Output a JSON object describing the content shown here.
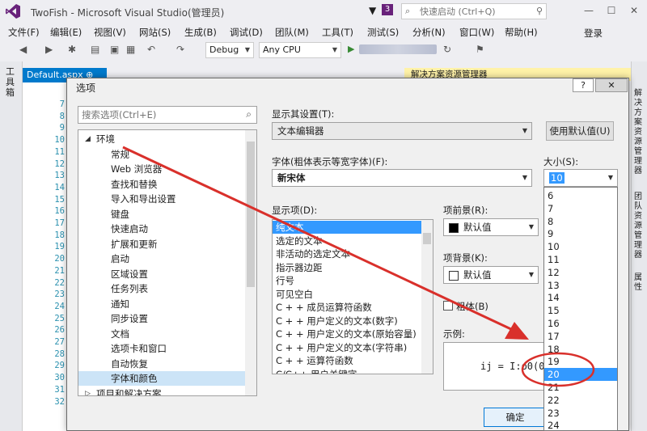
{
  "window": {
    "title": "TwoFish - Microsoft Visual Studio(管理员)",
    "notification_count": "3",
    "quick_launch_placeholder": "快速启动 (Ctrl+Q)",
    "minimize": "—",
    "maximize": "☐",
    "close": "✕"
  },
  "menu": {
    "items": [
      "文件(F)",
      "编辑(E)",
      "视图(V)",
      "网站(S)",
      "生成(B)",
      "调试(D)",
      "团队(M)",
      "工具(T)",
      "测试(S)",
      "分析(N)",
      "窗口(W)",
      "帮助(H)"
    ],
    "signin": "登录"
  },
  "toolbar": {
    "configuration": "Debug",
    "platform": "Any CPU"
  },
  "left_dock": {
    "label": "工具箱"
  },
  "editor": {
    "tab": "Default.aspx",
    "tab_pin": "⊕",
    "line_numbers": [
      "7",
      "8",
      "9",
      "10",
      "11",
      "12",
      "13",
      "14",
      "15",
      "16",
      "17",
      "18",
      "19",
      "20",
      "21",
      "22",
      "23",
      "24",
      "25",
      "26",
      "27",
      "28",
      "29",
      "30",
      "31",
      "32"
    ]
  },
  "solution_explorer": {
    "title": "解决方案资源管理器"
  },
  "right_dock": {
    "tabs": [
      "解决方案资源管理器",
      "团队资源管理器",
      "属性"
    ]
  },
  "dialog": {
    "title": "选项",
    "help_button": "?",
    "close_button": "✕",
    "search_placeholder": "搜索选项(Ctrl+E)",
    "tree": [
      {
        "label": "环境",
        "expanded": true,
        "top": true
      },
      {
        "label": "常规"
      },
      {
        "label": "Web 浏览器"
      },
      {
        "label": "查找和替换"
      },
      {
        "label": "导入和导出设置"
      },
      {
        "label": "键盘"
      },
      {
        "label": "快速启动"
      },
      {
        "label": "扩展和更新"
      },
      {
        "label": "启动"
      },
      {
        "label": "区域设置"
      },
      {
        "label": "任务列表"
      },
      {
        "label": "通知"
      },
      {
        "label": "同步设置"
      },
      {
        "label": "文档"
      },
      {
        "label": "选项卡和窗口"
      },
      {
        "label": "自动恢复"
      },
      {
        "label": "字体和颜色",
        "selected": true
      },
      {
        "label": "项目和解决方案",
        "top": true,
        "expanded": false
      }
    ],
    "show_settings_label": "显示其设置(T):",
    "show_settings_value": "文本编辑器",
    "use_defaults_button": "使用默认值(U)",
    "font_label": "字体(粗体表示等宽字体)(F):",
    "font_value": "新宋体",
    "size_label": "大小(S):",
    "size_value": "10",
    "display_items_label": "显示项(D):",
    "display_items": [
      "纯文本",
      "选定的文本",
      "非活动的选定文本",
      "指示器边距",
      "行号",
      "可见空白",
      "C + + 成员运算符函数",
      "C + + 用户定义的文本(数字)",
      "C + + 用户定义的文本(原始容量)",
      "C + + 用户定义的文本(字符串)",
      "C + + 运算符函数",
      "C/C++ 用户关键字"
    ],
    "foreground_label": "项前景(R):",
    "foreground_value": "默认值",
    "background_label": "项背景(K):",
    "background_value": "默认值",
    "bold_label": "粗体(B)",
    "sample_label": "示例:",
    "sample_text": "ij = I:o0(0",
    "ok_button": "确定",
    "size_options": [
      "6",
      "7",
      "8",
      "9",
      "10",
      "11",
      "12",
      "13",
      "14",
      "15",
      "16",
      "17",
      "18",
      "19",
      "20",
      "21",
      "22",
      "23",
      "24"
    ],
    "size_highlighted": "20"
  },
  "colors": {
    "accent": "#007acc",
    "selection": "#3399ff",
    "annotation": "#d9302b"
  }
}
